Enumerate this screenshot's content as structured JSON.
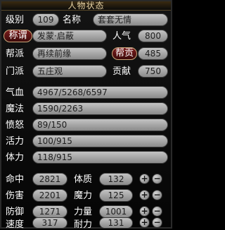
{
  "window": {
    "title": "人物状态"
  },
  "basic": {
    "level_label": "级别",
    "level_value": "109",
    "name_label": "名称",
    "name_value": "套套无情",
    "title_btn": "称谓",
    "title_value": "发蒙·启蔽",
    "popularity_label": "人气",
    "popularity_value": "800",
    "guild_label": "帮派",
    "guild_value": "再续前缘",
    "contrib_btn": "帮贡",
    "contrib_value": "485",
    "sect_label": "门派",
    "sect_value": "五庄观",
    "devote_label": "贡献",
    "devote_value": "750"
  },
  "stats": {
    "hp_label": "气血",
    "hp_value": "4967/5268/6597",
    "mp_label": "魔法",
    "mp_value": "1590/2263",
    "anger_label": "愤怒",
    "anger_value": "89/150",
    "vitality_label": "活力",
    "vitality_value": "100/915",
    "stamina_label": "体力",
    "stamina_value": "118/915"
  },
  "attributes": {
    "hit_label": "命中",
    "hit_value": "2821",
    "con_label": "体质",
    "con_value": "132",
    "dmg_label": "伤害",
    "dmg_value": "2201",
    "magic_label": "魔力",
    "magic_value": "125",
    "def_label": "防御",
    "def_value": "1271",
    "str_label": "力量",
    "str_value": "1001",
    "speed_label": "速度",
    "speed_value": "317",
    "end_label": "耐力",
    "end_value": "131",
    "plus": "+",
    "minus": "−"
  }
}
